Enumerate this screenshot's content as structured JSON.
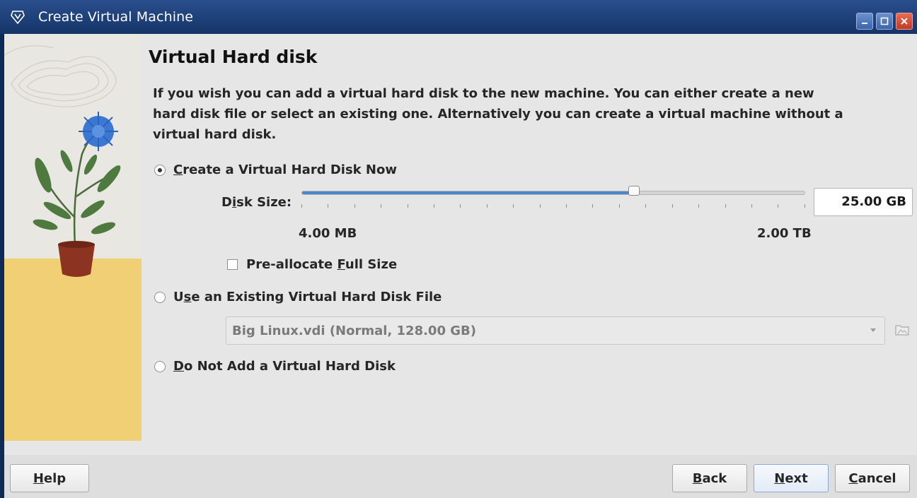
{
  "window": {
    "title": "Create Virtual Machine"
  },
  "page": {
    "heading": "Virtual Hard disk",
    "description": "If you wish you can add a virtual hard disk to the new machine. You can either create a new hard disk file or select an existing one. Alternatively you can create a virtual machine without a virtual hard disk."
  },
  "options": {
    "create_now": {
      "mnemonic": "C",
      "label_rest": "reate a Virtual Hard Disk Now",
      "selected": true
    },
    "use_existing": {
      "label_pre": "U",
      "mnemonic": "s",
      "label_rest": "e an Existing Virtual Hard Disk File",
      "selected": false
    },
    "do_not_add": {
      "mnemonic": "D",
      "label_rest": "o Not Add a Virtual Hard Disk",
      "selected": false
    }
  },
  "disk_size": {
    "label_pre": "D",
    "mnemonic": "i",
    "label_rest": "sk Size:",
    "value": "25.00 GB",
    "min_label": "4.00 MB",
    "max_label": "2.00 TB",
    "slider_fraction": 0.66
  },
  "preallocate": {
    "label_pre": "Pre-allocate ",
    "mnemonic": "F",
    "label_rest": "ull Size",
    "checked": false
  },
  "existing_file": {
    "selected": "Big Linux.vdi (Normal, 128.00 GB)"
  },
  "buttons": {
    "help": {
      "mnemonic": "H",
      "rest": "elp"
    },
    "back": {
      "mnemonic": "B",
      "rest": "ack"
    },
    "next": {
      "mnemonic": "N",
      "rest": "ext"
    },
    "cancel": {
      "mnemonic": "C",
      "rest": "ancel"
    }
  },
  "colors": {
    "accent": "#4f86c9",
    "titlebar": "#1d3f78",
    "dialog_bg": "#e6e6e6"
  }
}
